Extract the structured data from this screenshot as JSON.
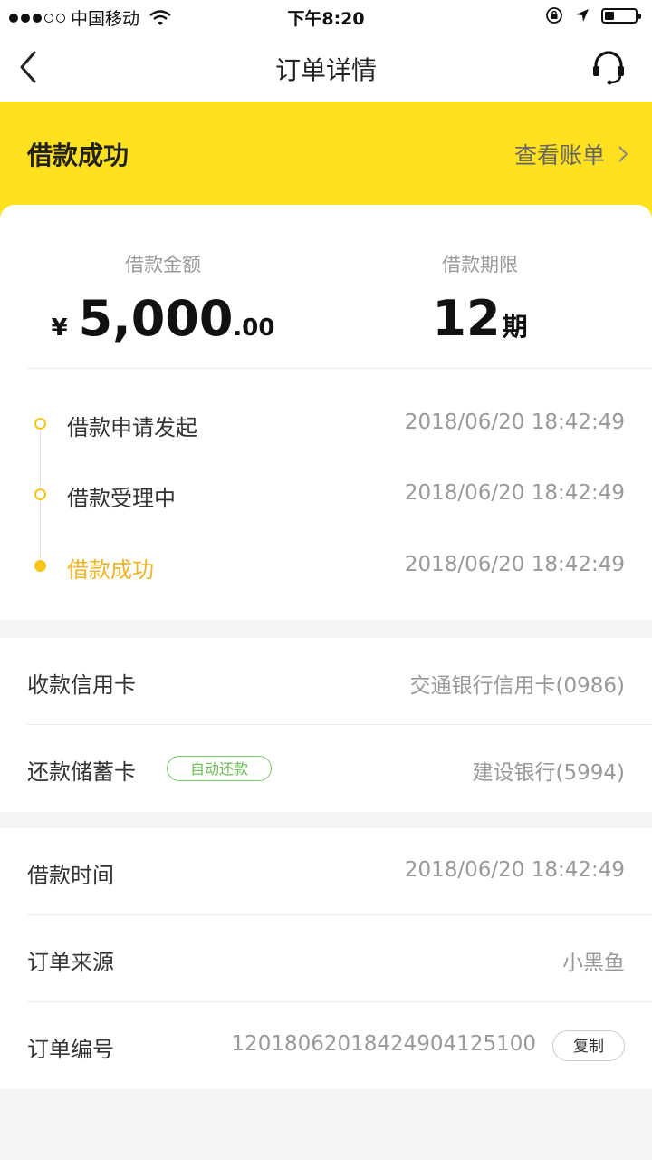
{
  "status_bar": {
    "carrier": "中国移动",
    "time": "下午8:20",
    "battery_level": 0.3
  },
  "nav": {
    "title": "订单详情"
  },
  "banner": {
    "status": "借款成功",
    "link_label": "查看账单"
  },
  "summary": {
    "amount_label": "借款金额",
    "currency": "¥",
    "amount_integer": "5,000",
    "amount_decimal": ".00",
    "term_label": "借款期限",
    "term_number": "12",
    "term_unit": "期"
  },
  "timeline": [
    {
      "label": "借款申请发起",
      "time": "2018/06/20 18:42:49"
    },
    {
      "label": "借款受理中",
      "time": "2018/06/20 18:42:49"
    },
    {
      "label": "借款成功",
      "time": "2018/06/20 18:42:49"
    }
  ],
  "cards_section": {
    "receive_label": "收款信用卡",
    "receive_value": "交通银行信用卡(0986)",
    "repay_label": "还款储蓄卡",
    "repay_badge": "自动还款",
    "repay_value": "建设银行(5994)"
  },
  "order_section": {
    "time_label": "借款时间",
    "time_value": "2018/06/20 18:42:49",
    "source_label": "订单来源",
    "source_value": "小黑鱼",
    "number_label": "订单编号",
    "number_value": "1201806201842490412510​0",
    "copy_label": "复制"
  },
  "colors": {
    "brand_yellow": "#ffe11f",
    "timeline_yellow": "#f5c518",
    "auto_green": "#6bbd55"
  },
  "icons": [
    "back-icon",
    "headset-icon",
    "chevron-right-icon",
    "wifi-icon",
    "lock-rotation-icon",
    "location-arrow-icon",
    "battery-icon"
  ]
}
